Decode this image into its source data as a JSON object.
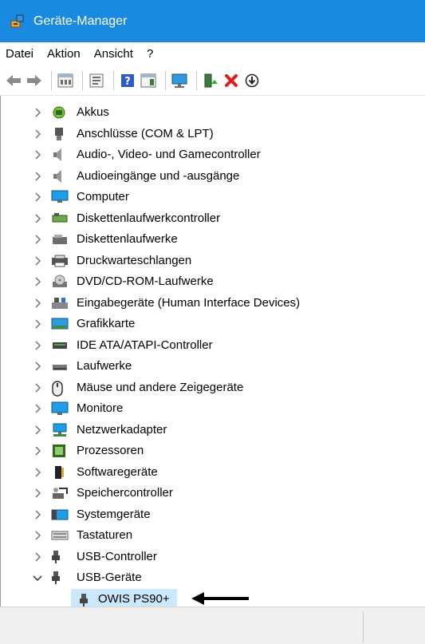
{
  "window": {
    "title": "Geräte-Manager",
    "app_icon": "device-manager-icon",
    "accent": "#1a8ae0"
  },
  "menu": [
    {
      "label": "Datei"
    },
    {
      "label": "Aktion"
    },
    {
      "label": "Ansicht"
    },
    {
      "label": "?"
    }
  ],
  "toolbar": [
    {
      "icon": "back-arrow-icon"
    },
    {
      "icon": "forward-arrow-icon"
    },
    {
      "icon": "device-view-icon"
    },
    {
      "icon": "properties-icon"
    },
    {
      "icon": "help-icon"
    },
    {
      "icon": "action-view-icon"
    },
    {
      "icon": "scan-hardware-icon"
    },
    {
      "icon": "update-driver-icon"
    },
    {
      "icon": "uninstall-red-x-icon"
    },
    {
      "icon": "download-circle-icon"
    }
  ],
  "tree": {
    "categories": [
      {
        "label": "Akkus",
        "icon": "battery-icon",
        "expanded": false
      },
      {
        "label": "Anschlüsse (COM & LPT)",
        "icon": "port-icon",
        "expanded": false
      },
      {
        "label": "Audio-, Video- und Gamecontroller",
        "icon": "speaker-icon",
        "expanded": false
      },
      {
        "label": "Audioeingänge und -ausgänge",
        "icon": "speaker-icon",
        "expanded": false
      },
      {
        "label": "Computer",
        "icon": "computer-monitor-icon",
        "expanded": false
      },
      {
        "label": "Diskettenlaufwerkcontroller",
        "icon": "controller-card-icon",
        "expanded": false
      },
      {
        "label": "Diskettenlaufwerke",
        "icon": "floppy-drive-icon",
        "expanded": false
      },
      {
        "label": "Druckwarteschlangen",
        "icon": "printer-icon",
        "expanded": false
      },
      {
        "label": "DVD/CD-ROM-Laufwerke",
        "icon": "dvd-drive-icon",
        "expanded": false
      },
      {
        "label": "Eingabegeräte (Human Interface Devices)",
        "icon": "hid-icon",
        "expanded": false
      },
      {
        "label": "Grafikkarte",
        "icon": "graphics-card-icon",
        "expanded": false
      },
      {
        "label": "IDE ATA/ATAPI-Controller",
        "icon": "ide-controller-icon",
        "expanded": false
      },
      {
        "label": "Laufwerke",
        "icon": "hard-drive-icon",
        "expanded": false
      },
      {
        "label": "Mäuse und andere Zeigegeräte",
        "icon": "mouse-icon",
        "expanded": false
      },
      {
        "label": "Monitore",
        "icon": "monitor-icon",
        "expanded": false
      },
      {
        "label": "Netzwerkadapter",
        "icon": "network-adapter-icon",
        "expanded": false
      },
      {
        "label": "Prozessoren",
        "icon": "processor-icon",
        "expanded": false
      },
      {
        "label": "Softwaregeräte",
        "icon": "software-device-icon",
        "expanded": false
      },
      {
        "label": "Speichercontroller",
        "icon": "storage-controller-icon",
        "expanded": false
      },
      {
        "label": "Systemgeräte",
        "icon": "system-devices-icon",
        "expanded": false
      },
      {
        "label": "Tastaturen",
        "icon": "keyboard-icon",
        "expanded": false
      },
      {
        "label": "USB-Controller",
        "icon": "usb-plug-icon",
        "expanded": false
      },
      {
        "label": "USB-Geräte",
        "icon": "usb-plug-icon",
        "expanded": true
      }
    ],
    "selected_child": {
      "label": "OWIS PS90+",
      "icon": "usb-plug-icon",
      "highlight": "#cce8ff"
    }
  },
  "annotation": {
    "icon": "left-arrow-pointer-icon"
  }
}
